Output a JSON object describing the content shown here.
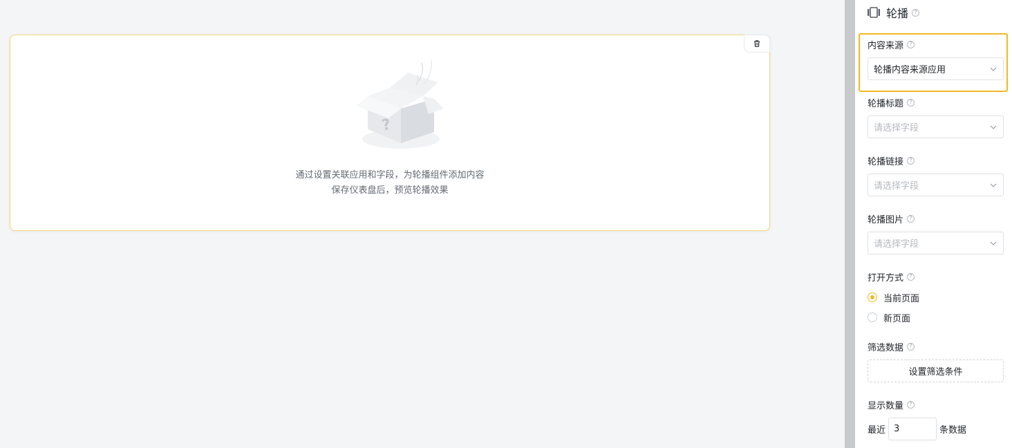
{
  "canvas": {
    "empty_line1": "通过设置关联应用和字段，为轮播组件添加内容",
    "empty_line2": "保存仪表盘后，预览轮播效果"
  },
  "panel": {
    "title": "轮播",
    "help": "?",
    "content_source": {
      "label": "内容来源",
      "value": "轮播内容来源应用"
    },
    "carousel_title": {
      "label": "轮播标题",
      "placeholder": "请选择字段"
    },
    "carousel_link": {
      "label": "轮播链接",
      "placeholder": "请选择字段"
    },
    "carousel_image": {
      "label": "轮播图片",
      "placeholder": "请选择字段"
    },
    "open_mode": {
      "label": "打开方式",
      "options": [
        {
          "label": "当前页面",
          "checked": true
        },
        {
          "label": "新页面",
          "checked": false
        }
      ]
    },
    "filter": {
      "label": "筛选数据",
      "button": "设置筛选条件"
    },
    "display_count": {
      "label": "显示数量",
      "prefix": "最近",
      "value": "3",
      "suffix": "条数据"
    }
  },
  "colors": {
    "accent": "#f2b826",
    "widget_border": "#f7d774"
  }
}
